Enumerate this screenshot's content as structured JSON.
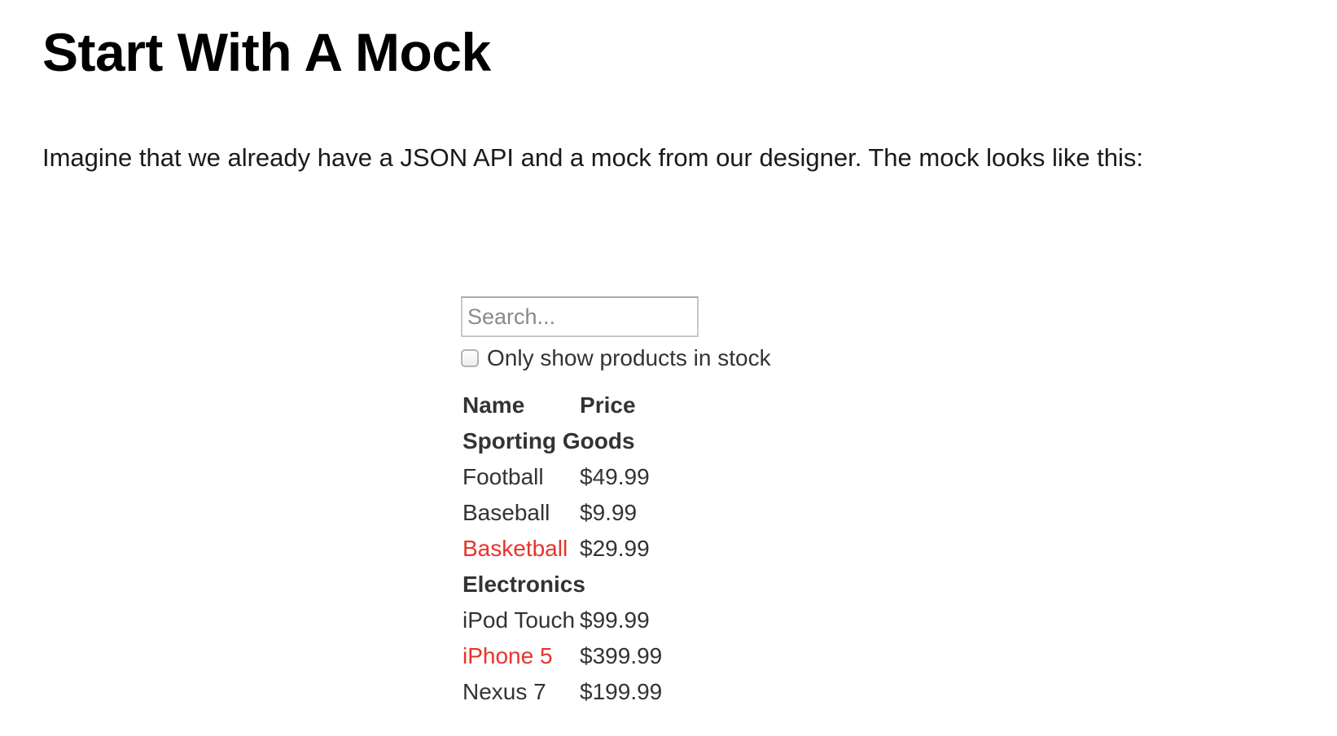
{
  "page": {
    "title": "Start With A Mock",
    "intro": "Imagine that we already have a JSON API and a mock from our designer. The mock looks like this:"
  },
  "mock": {
    "search": {
      "placeholder": "Search...",
      "value": ""
    },
    "stock_filter": {
      "label": "Only show products in stock",
      "checked": false
    },
    "table": {
      "columns": [
        "Name",
        "Price"
      ],
      "categories": [
        {
          "name": "Sporting Goods",
          "products": [
            {
              "name": "Football",
              "price": "$49.99",
              "stocked": true
            },
            {
              "name": "Baseball",
              "price": "$9.99",
              "stocked": true
            },
            {
              "name": "Basketball",
              "price": "$29.99",
              "stocked": false
            }
          ]
        },
        {
          "name": "Electronics",
          "products": [
            {
              "name": "iPod Touch",
              "price": "$99.99",
              "stocked": true
            },
            {
              "name": "iPhone 5",
              "price": "$399.99",
              "stocked": false
            },
            {
              "name": "Nexus 7",
              "price": "$199.99",
              "stocked": true
            }
          ]
        }
      ]
    },
    "colors": {
      "text": "#333333",
      "out_of_stock": "#e8332a",
      "input_border": "#c8c8c8"
    }
  }
}
